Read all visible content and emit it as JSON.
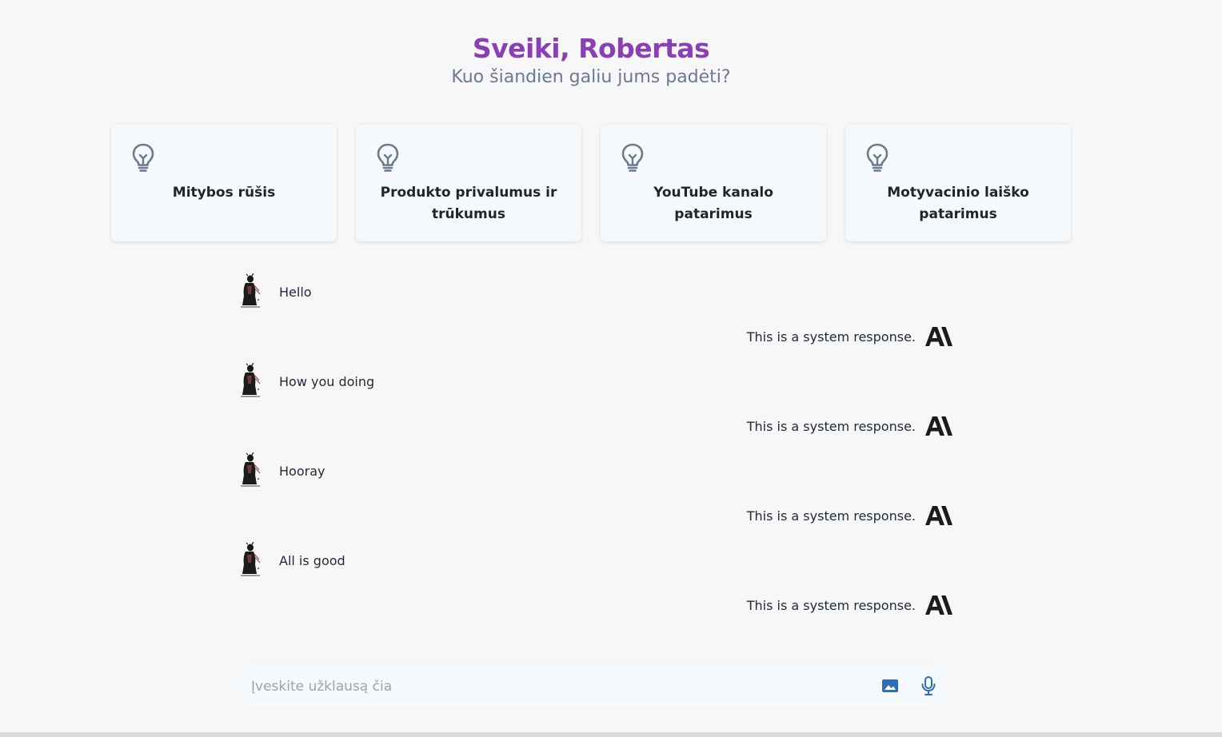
{
  "greeting": {
    "title": "Sveiki, Robertas",
    "subtitle": "Kuo šiandien galiu jums padėti?"
  },
  "suggestions": [
    {
      "label": "Mitybos rūšis",
      "icon": "lightbulb-icon"
    },
    {
      "label": "Produkto privalumus ir trūkumus",
      "icon": "lightbulb-icon"
    },
    {
      "label": "YouTube kanalo patarimus",
      "icon": "lightbulb-icon"
    },
    {
      "label": "Motyvacinio laiško patarimus",
      "icon": "lightbulb-icon"
    }
  ],
  "messages": [
    {
      "role": "user",
      "text": "Hello",
      "icon": "user-avatar"
    },
    {
      "role": "bot",
      "text": "This is a system response.",
      "icon": "anthropic-logo-icon"
    },
    {
      "role": "user",
      "text": "How you doing",
      "icon": "user-avatar"
    },
    {
      "role": "bot",
      "text": "This is a system response.",
      "icon": "anthropic-logo-icon"
    },
    {
      "role": "user",
      "text": "Hooray",
      "icon": "user-avatar"
    },
    {
      "role": "bot",
      "text": "This is a system response.",
      "icon": "anthropic-logo-icon"
    },
    {
      "role": "user",
      "text": "All is good",
      "icon": "user-avatar"
    },
    {
      "role": "bot",
      "text": "This is a system response.",
      "icon": "anthropic-logo-icon"
    }
  ],
  "input": {
    "placeholder": "Įveskite užklausą čia",
    "value": "",
    "icons": [
      "image-icon",
      "microphone-icon"
    ]
  },
  "colors": {
    "title": "#8a3fb5",
    "subtitle": "#6b7a90",
    "background": "#f7f7f7",
    "card": "#f6f9fc",
    "input_icon": "#2f6eb5"
  }
}
